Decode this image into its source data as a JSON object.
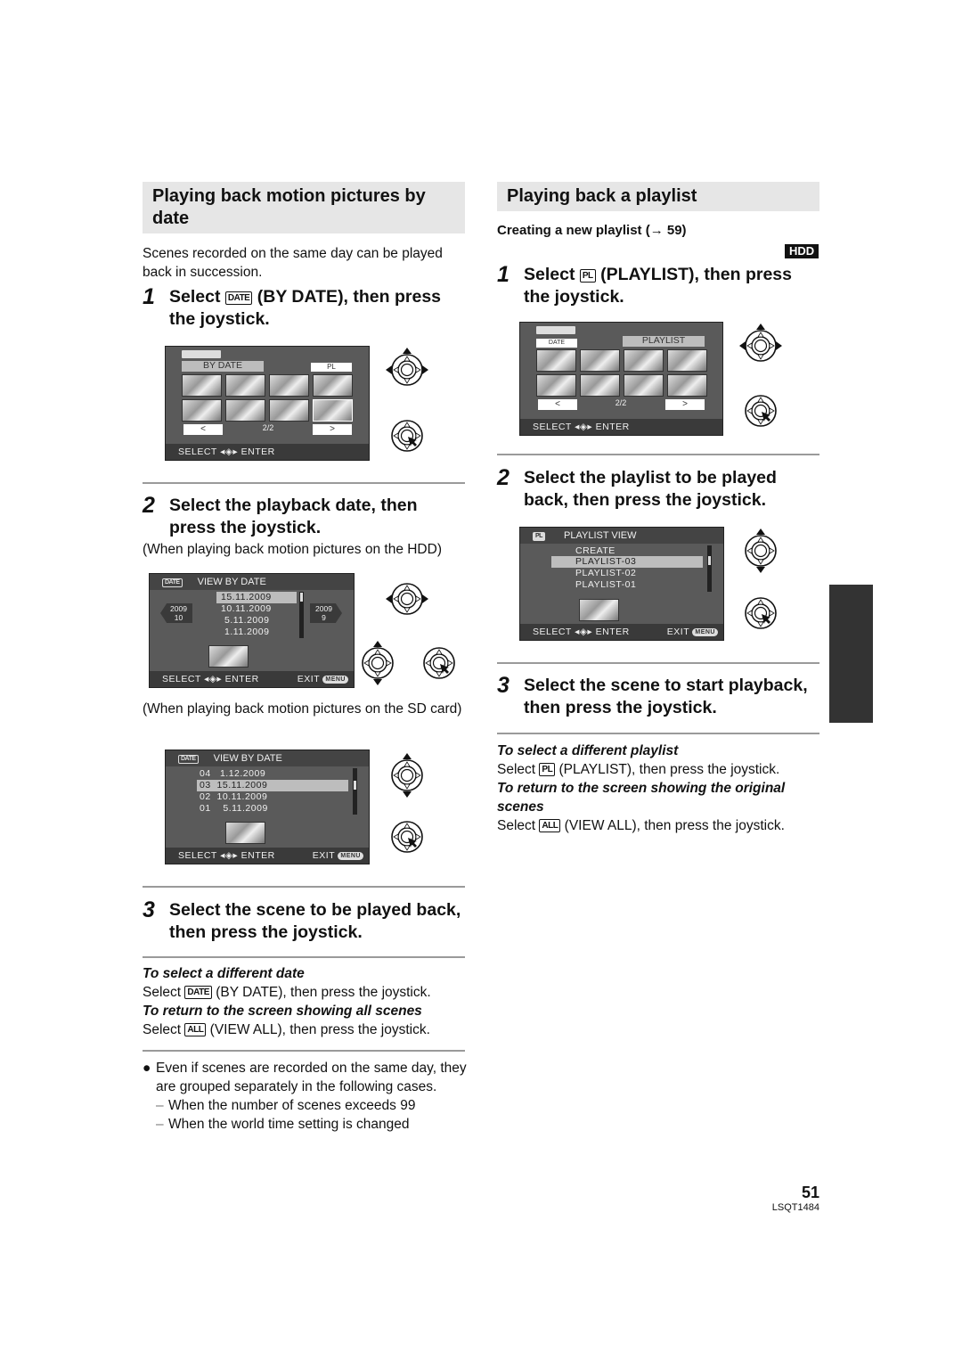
{
  "left": {
    "section_title": "Playing back motion pictures by date",
    "intro": "Scenes recorded on the same day can be played back in succession.",
    "step1": {
      "num": "1",
      "pre": "Select",
      "icon": "DATE",
      "post": "(BY DATE), then press the joystick."
    },
    "screen1": {
      "tab_active": "BY DATE",
      "tab_other": "PL",
      "prev": "<",
      "next": ">",
      "page": "2/2",
      "select_label": "SELECT",
      "enter_label": "ENTER"
    },
    "step2": {
      "num": "2",
      "text": "Select the playback date, then press the joystick."
    },
    "hdd_caption": "(When playing back motion pictures on the HDD)",
    "screen2": {
      "icon": "DATE",
      "title": "VIEW BY DATE",
      "dates": [
        "15.11.2009",
        "10.11.2009",
        "5.11.2009",
        "1.11.2009"
      ],
      "prev_year": "2009",
      "prev_month": "10",
      "next_year": "2009",
      "next_month": "9",
      "select_label": "SELECT",
      "enter_label": "ENTER",
      "exit_label": "EXIT",
      "menu_label": "MENU"
    },
    "sd_caption": "(When playing back motion pictures on the SD card)",
    "screen3": {
      "icon": "DATE",
      "title": "VIEW BY DATE",
      "rows": [
        {
          "no": "04",
          "date": "1.12.2009"
        },
        {
          "no": "03",
          "date": "15.11.2009"
        },
        {
          "no": "02",
          "date": "10.11.2009"
        },
        {
          "no": "01",
          "date": "5.11.2009"
        }
      ],
      "select_label": "SELECT",
      "enter_label": "ENTER",
      "exit_label": "EXIT",
      "menu_label": "MENU"
    },
    "step3": {
      "num": "3",
      "text": "Select the scene to be played back, then press the joystick."
    },
    "note1_head": "To select a different date",
    "note1_pre": "Select",
    "note1_icon": "DATE",
    "note1_post": "(BY DATE), then press the joystick.",
    "note2_head": "To return to the screen showing all scenes",
    "note2_pre": "Select",
    "note2_icon": "ALL",
    "note2_post": "(VIEW ALL), then press the joystick.",
    "bullet": "Even if scenes are recorded on the same day, they are grouped separately in the following cases.",
    "dash1": "When the number of scenes exceeds 99",
    "dash2": "When the world time setting is changed"
  },
  "right": {
    "section_title": "Playing back a playlist",
    "subhead": "Creating a new playlist (→ 59)",
    "badge": "HDD",
    "step1": {
      "num": "1",
      "pre": "Select",
      "icon": "PL",
      "post": "(PLAYLIST), then press the joystick."
    },
    "screen1": {
      "tab_other": "DATE",
      "tab_active": "PLAYLIST",
      "prev": "<",
      "next": ">",
      "page": "2/2",
      "select_label": "SELECT",
      "enter_label": "ENTER"
    },
    "step2": {
      "num": "2",
      "text": "Select the playlist to be played back, then press the joystick."
    },
    "screen2": {
      "icon": "PL",
      "title": "PLAYLIST VIEW",
      "items": [
        "CREATE",
        "PLAYLIST-03",
        "PLAYLIST-02",
        "PLAYLIST-01"
      ],
      "select_label": "SELECT",
      "enter_label": "ENTER",
      "exit_label": "EXIT",
      "menu_label": "MENU"
    },
    "step3": {
      "num": "3",
      "text": "Select the scene to start playback, then press the joystick."
    },
    "note1_head": "To select a different playlist",
    "note1_pre": "Select",
    "note1_icon": "PL",
    "note1_post": "(PLAYLIST), then press the joystick.",
    "note2_head": "To return to the screen showing the original scenes",
    "note2_pre": "Select",
    "note2_icon": "ALL",
    "note2_post": "(VIEW ALL), then press the joystick."
  },
  "footer": {
    "page_number": "51",
    "doc_code": "LSQT1484"
  }
}
